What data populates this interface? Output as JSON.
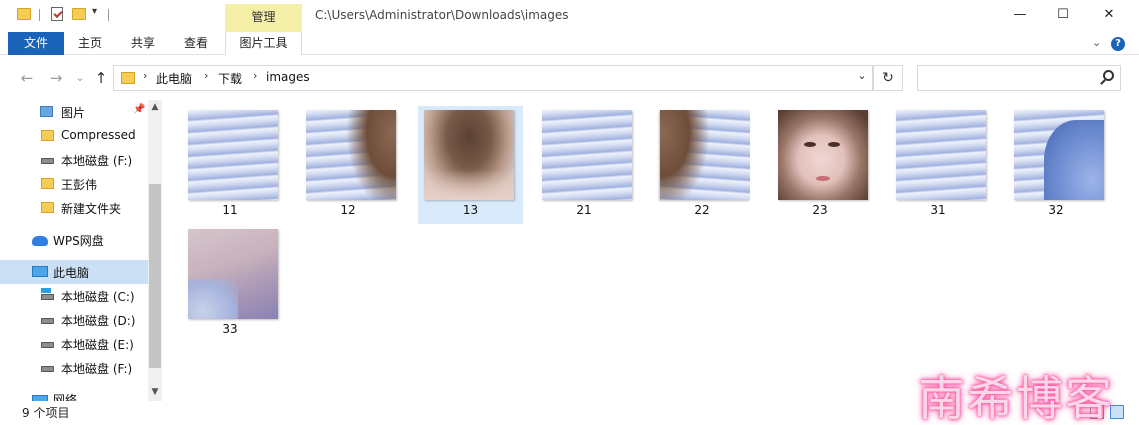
{
  "titlebar": {
    "context_tab": "管理",
    "path": "C:\\Users\\Administrator\\Downloads\\images",
    "minimize": "—",
    "maximize": "☐",
    "close": "✕"
  },
  "ribbon": {
    "file": "文件",
    "tabs": [
      "主页",
      "共享",
      "查看"
    ],
    "tools_tab": "图片工具",
    "help": "?"
  },
  "nav": {
    "back": "←",
    "forward": "→",
    "recent": "⌄",
    "up": "↑",
    "breadcrumbs": [
      "此电脑",
      "下载",
      "images"
    ],
    "refresh": "↻",
    "search_placeholder": ""
  },
  "sidebar": {
    "items": [
      {
        "label": "图片",
        "icon": "pictures-icon",
        "pinned": true
      },
      {
        "label": "Compressed",
        "icon": "folder-icon"
      },
      {
        "label": "本地磁盘 (F:)",
        "icon": "drive-icon"
      },
      {
        "label": "王彭伟",
        "icon": "folder-icon"
      },
      {
        "label": "新建文件夹",
        "icon": "folder-icon"
      },
      {
        "label": "WPS网盘",
        "icon": "cloud-icon"
      },
      {
        "label": "此电脑",
        "icon": "pc-icon",
        "selected": true
      },
      {
        "label": "本地磁盘 (C:)",
        "icon": "windows-drive-icon"
      },
      {
        "label": "本地磁盘 (D:)",
        "icon": "drive-icon"
      },
      {
        "label": "本地磁盘 (E:)",
        "icon": "drive-icon"
      },
      {
        "label": "本地磁盘 (F:)",
        "icon": "drive-icon"
      },
      {
        "label": "网络",
        "icon": "network-icon"
      }
    ]
  },
  "files": [
    {
      "name": "11",
      "thumb": "blinds"
    },
    {
      "name": "12",
      "thumb": "blinds-hair"
    },
    {
      "name": "13",
      "thumb": "hair-top",
      "selected": true
    },
    {
      "name": "21",
      "thumb": "blinds"
    },
    {
      "name": "22",
      "thumb": "blinds-hair"
    },
    {
      "name": "23",
      "thumb": "face"
    },
    {
      "name": "31",
      "thumb": "blinds"
    },
    {
      "name": "32",
      "thumb": "shoulder"
    },
    {
      "name": "33",
      "thumb": "neck"
    }
  ],
  "status": {
    "count": "9 个项目"
  },
  "watermark": "南希博客",
  "colors": {
    "accent": "#1a63b8",
    "context_tab": "#f5f0a8",
    "selection": "#cce0f5"
  }
}
